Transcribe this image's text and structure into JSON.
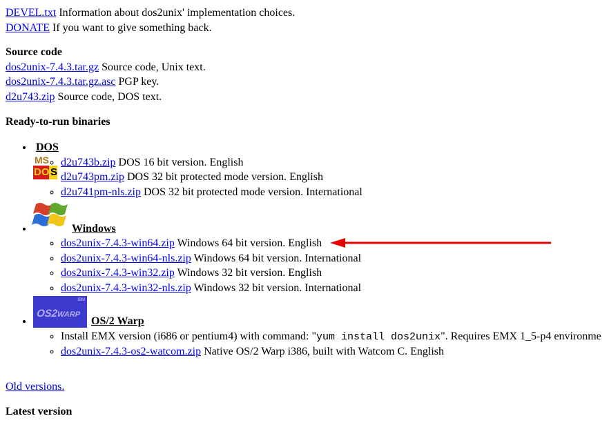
{
  "topLinks": [
    {
      "name": "devel-link",
      "label": "DEVEL.txt",
      "desc": "Information about dos2unix' implementation choices."
    },
    {
      "name": "donate-link",
      "label": "DONATE",
      "desc": "If you want to give something back."
    }
  ],
  "sourceCode": {
    "heading": "Source code",
    "items": [
      {
        "name": "src-targz",
        "label": "dos2unix-7.4.3.tar.gz",
        "desc": "Source code, Unix text."
      },
      {
        "name": "src-asc",
        "label": "dos2unix-7.4.3.tar.gz.asc",
        "desc": "PGP key."
      },
      {
        "name": "src-zip",
        "label": "d2u743.zip",
        "desc": "Source code, DOS text."
      }
    ]
  },
  "binariesHeading": "Ready-to-run binaries",
  "platforms": {
    "dos": {
      "label": "DOS",
      "items": [
        {
          "name": "dos-16",
          "label": "d2u743b.zip",
          "desc": "DOS 16 bit version. English"
        },
        {
          "name": "dos-32pm",
          "label": "d2u743pm.zip",
          "desc": "DOS 32 bit protected mode version. English"
        },
        {
          "name": "dos-32pm-nls",
          "label": "d2u741pm-nls.zip",
          "desc": "DOS 32 bit protected mode version. International"
        }
      ]
    },
    "windows": {
      "label": "Windows",
      "items": [
        {
          "name": "win64",
          "label": "dos2unix-7.4.3-win64.zip",
          "desc": "Windows 64 bit version. English",
          "arrow": true
        },
        {
          "name": "win64-nls",
          "label": "dos2unix-7.4.3-win64-nls.zip",
          "desc": "Windows 64 bit version. International"
        },
        {
          "name": "win32",
          "label": "dos2unix-7.4.3-win32.zip",
          "desc": "Windows 32 bit version. English"
        },
        {
          "name": "win32-nls",
          "label": "dos2unix-7.4.3-win32-nls.zip",
          "desc": "Windows 32 bit version. International"
        }
      ]
    },
    "os2": {
      "label": "OS/2 Warp",
      "emx": {
        "pre": "Install EMX version (i686 or pentium4) with command: \"",
        "cmd": "yum install dos2unix",
        "post": "\". Requires EMX 1_5-p4 environme"
      },
      "watcom": {
        "name": "os2-watcom",
        "label": "dos2unix-7.4.3-os2-watcom.zip",
        "desc": "Native OS/2 Warp i386, built with Watcom C. English"
      }
    }
  },
  "oldVersions": "Old versions.",
  "latestHeading": "Latest version"
}
